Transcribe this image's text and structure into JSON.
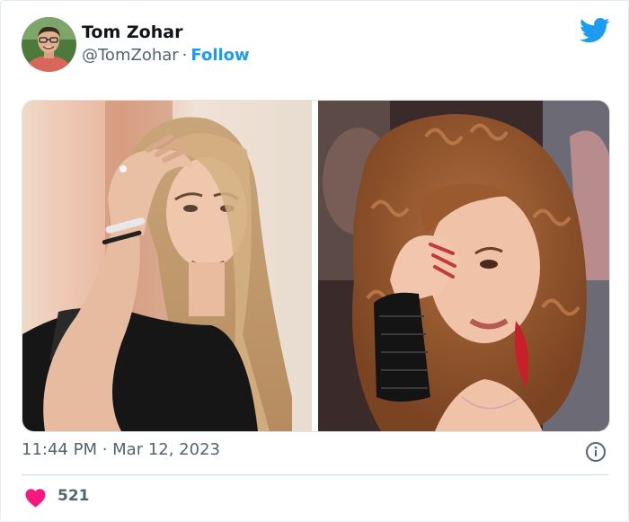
{
  "tweet": {
    "author": {
      "name": "Tom Zohar",
      "handle": "@TomZohar",
      "separator": "·",
      "follow_label": "Follow",
      "avatar": "profile-photo"
    },
    "media": [
      {
        "kind": "photo",
        "description": "woman with long blonde hair touching her head"
      },
      {
        "kind": "photo",
        "description": "woman with curly auburn hair touching her forehead"
      }
    ],
    "timestamp": "11:44 PM · Mar 12, 2023",
    "likes": "521",
    "icons": {
      "brand": "twitter-bird-icon",
      "info": "info-icon",
      "like": "heart-icon"
    },
    "colors": {
      "accent": "#1d9bf0",
      "heart": "#f91880",
      "muted_text": "#536471",
      "text": "#0f1419"
    }
  }
}
